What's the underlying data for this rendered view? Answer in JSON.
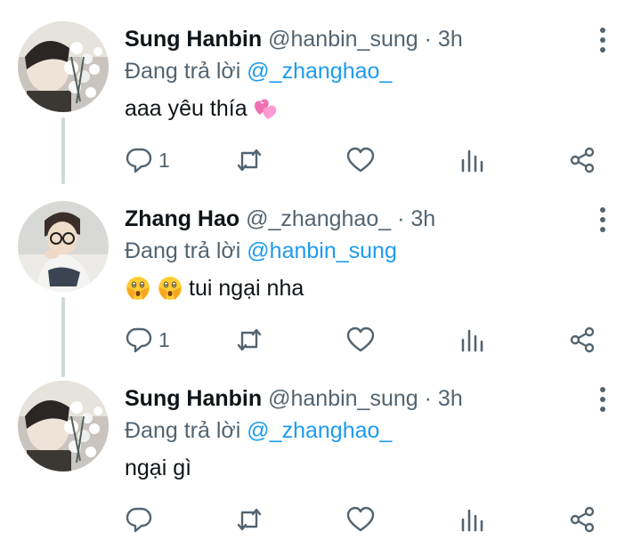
{
  "replies": [
    {
      "name": "Sung Hanbin",
      "handle": "@hanbin_sung",
      "separator": "·",
      "time": "3h",
      "replying_prefix": "Đang trả lời",
      "replying_to": "@_zhanghao_",
      "text": "aaa yêu thía",
      "emojis": [
        "two-hearts"
      ],
      "reply_count": "1",
      "avatar": "hanbin-avatar"
    },
    {
      "name": "Zhang Hao",
      "handle": "@_zhanghao_",
      "separator": "·",
      "time": "3h",
      "replying_prefix": "Đang trả lời",
      "replying_to": "@hanbin_sung",
      "text": "tui ngại nha",
      "emojis": [
        "face-with-open-eyes-and-hand-over-mouth",
        "face-with-open-eyes-and-hand-over-mouth"
      ],
      "reply_count": "1",
      "avatar": "zhanghao-avatar"
    },
    {
      "name": "Sung Hanbin",
      "handle": "@hanbin_sung",
      "separator": "·",
      "time": "3h",
      "replying_prefix": "Đang trả lời",
      "replying_to": "@_zhanghao_",
      "text": "ngại gì",
      "emojis": [],
      "reply_count": "",
      "avatar": "hanbin-avatar"
    }
  ],
  "colors": {
    "mention": "#1d9bf0",
    "secondary_text": "#536471",
    "thread_line": "#cfd9de",
    "heart_emoji": "#ff5fa8"
  }
}
